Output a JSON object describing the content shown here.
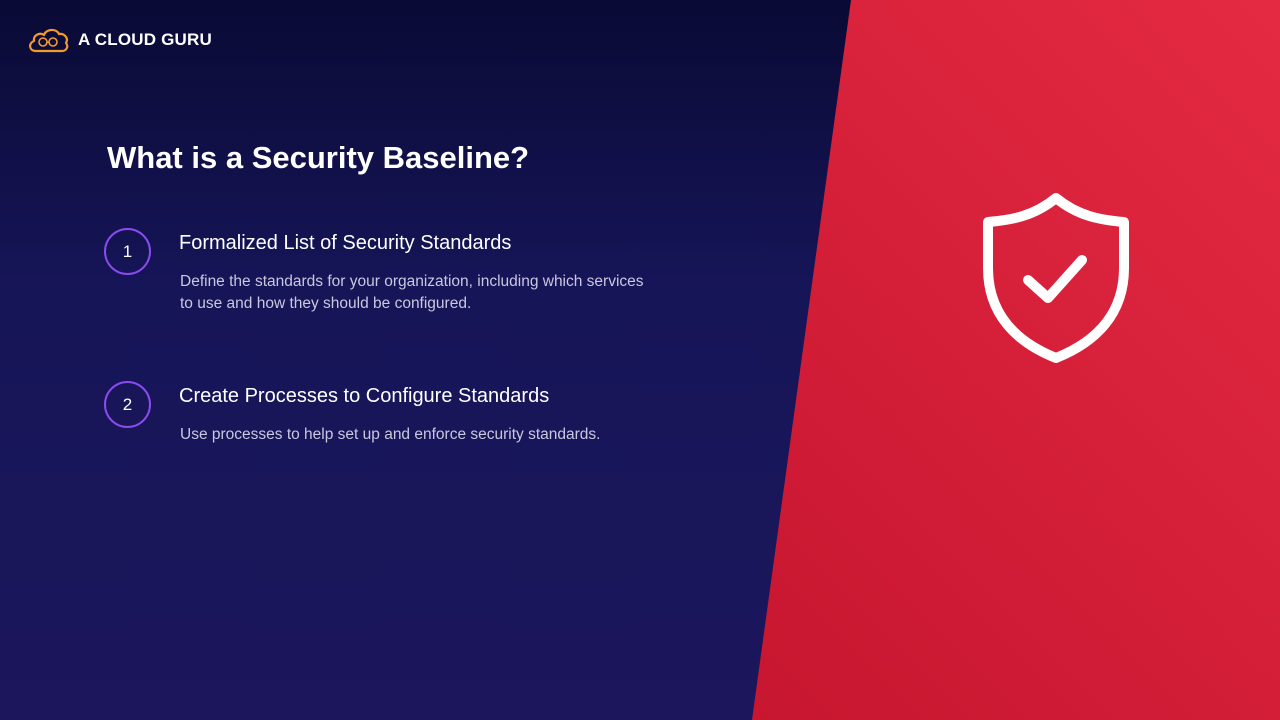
{
  "logo": {
    "text": "A CLOUD GURU",
    "icon": "cloud-guru-icon",
    "accent": "#f29b2b"
  },
  "slide": {
    "title": "What is a Security Baseline?",
    "items": [
      {
        "number": "1",
        "heading": "Formalized List of Security Standards",
        "description": "Define the standards for your organization, including which services to use and how they should be configured."
      },
      {
        "number": "2",
        "heading": "Create Processes to Configure Standards",
        "description": "Use processes to help set up and enforce security standards."
      }
    ]
  },
  "illustration": {
    "icon": "shield-check-icon"
  },
  "colors": {
    "background_top": "#0a0a35",
    "background_bottom": "#1c165c",
    "panel_red": "#d41c36",
    "badge_border": "#8a4cf0",
    "text_primary": "#ffffff",
    "text_secondary": "#c9c8df"
  }
}
